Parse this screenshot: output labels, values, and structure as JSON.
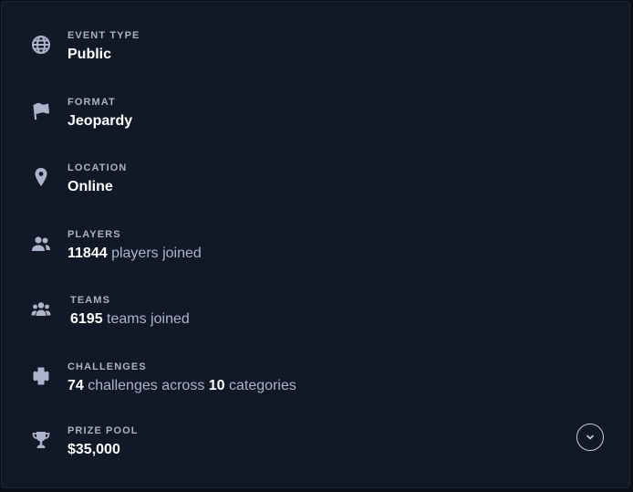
{
  "details": [
    {
      "icon": "globe-icon",
      "label": "EVENT TYPE",
      "value": "Public"
    },
    {
      "icon": "flag-icon",
      "label": "FORMAT",
      "value": "Jeopardy"
    },
    {
      "icon": "location-pin-icon",
      "label": "LOCATION",
      "value": "Online"
    },
    {
      "icon": "users-icon",
      "label": "PLAYERS",
      "count": "11844",
      "suffix": "players joined"
    },
    {
      "icon": "team-icon",
      "label": "TEAMS",
      "count": "6195",
      "suffix": "teams joined"
    },
    {
      "icon": "puzzle-icon",
      "label": "CHALLENGES",
      "count": "74",
      "middle": "challenges across",
      "count2": "10",
      "suffix": "categories"
    },
    {
      "icon": "trophy-icon",
      "label": "PRIZE POOL",
      "value": "$35,000"
    }
  ],
  "expand_icon": "chevron-down-icon",
  "colors": {
    "background": "#111826",
    "label": "#a9b3c6",
    "value": "#ffffff",
    "muted_text": "#aab5cc",
    "icon": "#aab5cc"
  }
}
